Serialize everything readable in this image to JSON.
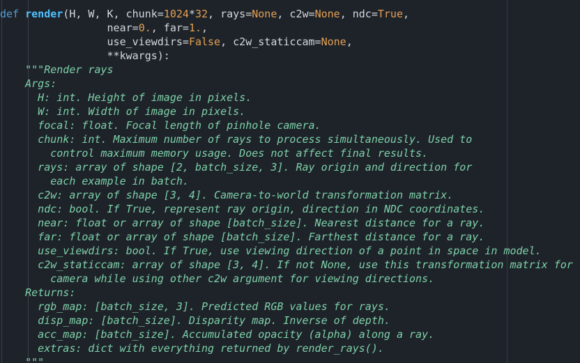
{
  "editor": {
    "lines": [
      [
        [
          "def",
          "kw"
        ],
        [
          " ",
          "pu"
        ],
        [
          "render",
          "fn"
        ],
        [
          "(H, W, K, chunk=",
          "id"
        ],
        [
          "1024",
          "nu"
        ],
        [
          "*",
          "op"
        ],
        [
          "32",
          "nu"
        ],
        [
          ", rays=",
          "id"
        ],
        [
          "None",
          "bi"
        ],
        [
          ", c2w=",
          "id"
        ],
        [
          "None",
          "bi"
        ],
        [
          ", ndc=",
          "id"
        ],
        [
          "True",
          "bi"
        ],
        [
          ",",
          "pu"
        ]
      ],
      [
        [
          "                 near=",
          "id"
        ],
        [
          "0.",
          "nu"
        ],
        [
          ", far=",
          "id"
        ],
        [
          "1.",
          "nu"
        ],
        [
          ",",
          "pu"
        ]
      ],
      [
        [
          "                 use_viewdirs=",
          "id"
        ],
        [
          "False",
          "bi"
        ],
        [
          ", c2w_staticcam=",
          "id"
        ],
        [
          "None",
          "bi"
        ],
        [
          ",",
          "pu"
        ]
      ],
      [
        [
          "                 **kwargs):",
          "id"
        ]
      ],
      [
        [
          "    \"\"\"Render rays",
          "doc"
        ]
      ],
      [
        [
          "    Args:",
          "doc"
        ]
      ],
      [
        [
          "      H: int. Height of image in pixels.",
          "doc"
        ]
      ],
      [
        [
          "      W: int. Width of image in pixels.",
          "doc"
        ]
      ],
      [
        [
          "      focal: float. Focal length of pinhole camera.",
          "doc"
        ]
      ],
      [
        [
          "      chunk: int. Maximum number of rays to process simultaneously. Used to",
          "doc"
        ]
      ],
      [
        [
          "        control maximum memory usage. Does not affect final results.",
          "doc"
        ]
      ],
      [
        [
          "      rays: array of shape [2, batch_size, 3]. Ray origin and direction for",
          "doc"
        ]
      ],
      [
        [
          "        each example in batch.",
          "doc"
        ]
      ],
      [
        [
          "      c2w: array of shape [3, 4]. Camera-to-world transformation matrix.",
          "doc"
        ]
      ],
      [
        [
          "      ndc: bool. If True, represent ray origin, direction in NDC coordinates.",
          "doc"
        ]
      ],
      [
        [
          "      near: float or array of shape [batch_size]. Nearest distance for a ray.",
          "doc"
        ]
      ],
      [
        [
          "      far: float or array of shape [batch_size]. Farthest distance for a ray.",
          "doc"
        ]
      ],
      [
        [
          "      use_viewdirs: bool. If True, use viewing direction of a point in space in model.",
          "doc"
        ]
      ],
      [
        [
          "      c2w_staticcam: array of shape [3, 4]. If not None, use this transformation matrix for",
          "doc"
        ]
      ],
      [
        [
          "        camera while using other c2w argument for viewing directions.",
          "doc"
        ]
      ],
      [
        [
          "    Returns:",
          "doc"
        ]
      ],
      [
        [
          "      rgb_map: [batch_size, 3]. Predicted RGB values for rays.",
          "doc"
        ]
      ],
      [
        [
          "      disp_map: [batch_size]. Disparity map. Inverse of depth.",
          "doc"
        ]
      ],
      [
        [
          "      acc_map: [batch_size]. Accumulated opacity (alpha) along a ray.",
          "doc"
        ]
      ],
      [
        [
          "      extras: dict with everything returned by render_rays().",
          "doc"
        ]
      ],
      [
        [
          "    \"\"\"",
          "doc"
        ]
      ]
    ]
  }
}
